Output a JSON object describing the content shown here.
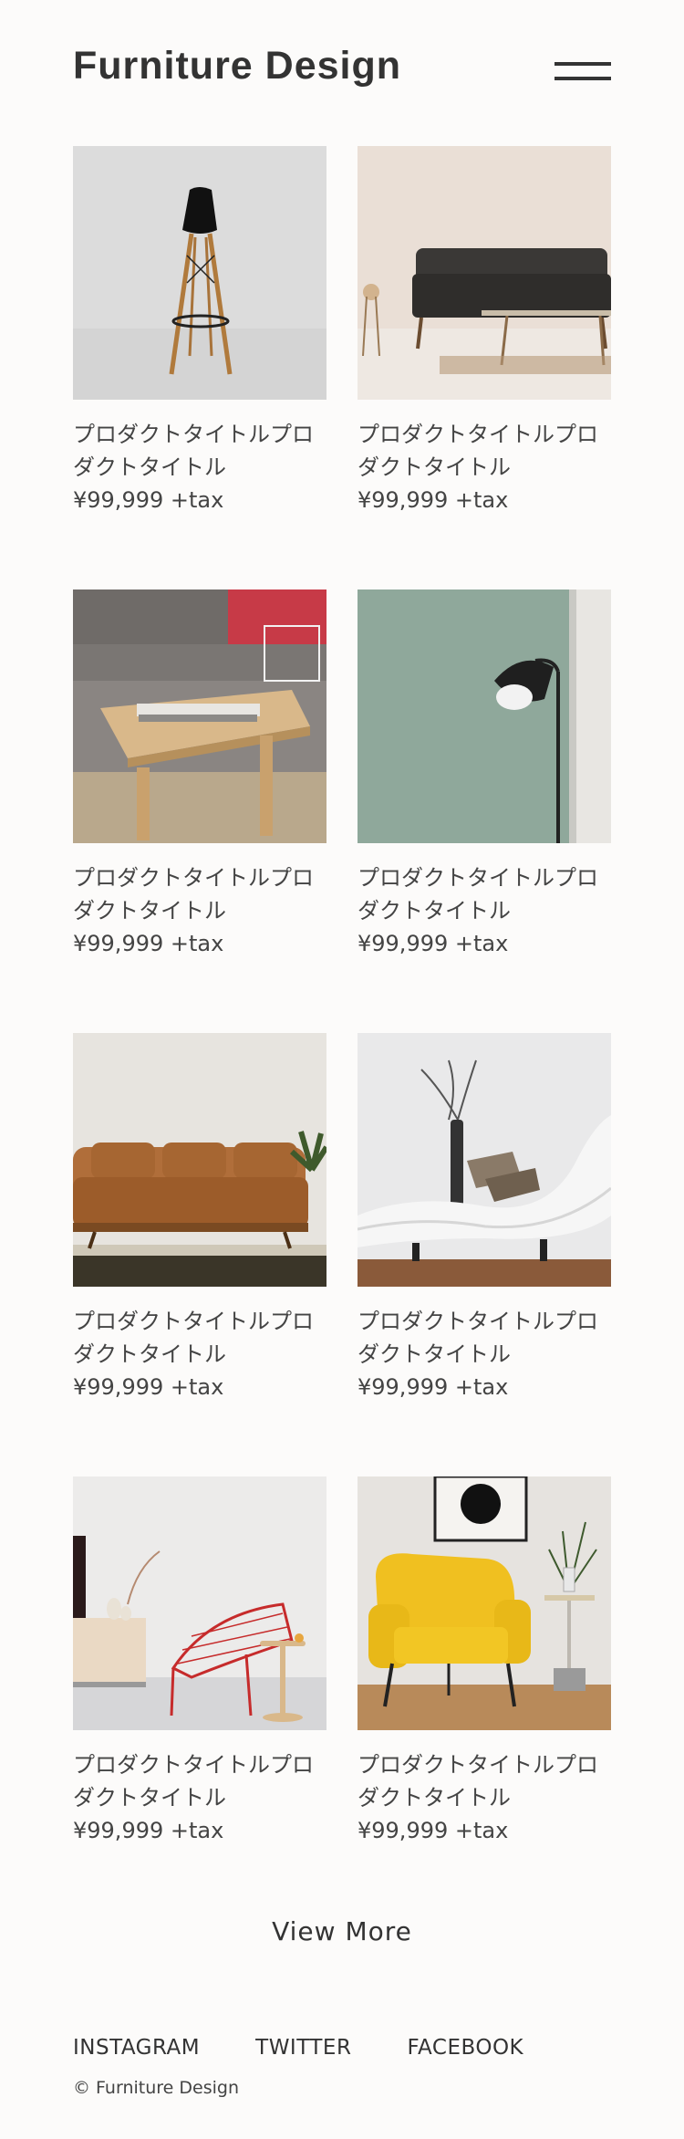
{
  "header": {
    "logo": "Furniture Design",
    "menu_icon": "hamburger-menu-icon"
  },
  "products": [
    {
      "image": "black-bar-stool",
      "title": "プロダクトタイトルプロダクトタイトル",
      "price": "¥99,999 +tax"
    },
    {
      "image": "dark-leather-sofa",
      "title": "プロダクトタイトルプロダクトタイトル",
      "price": "¥99,999 +tax"
    },
    {
      "image": "wooden-coffee-table",
      "title": "プロダクトタイトルプロダクトタイトル",
      "price": "¥99,999 +tax"
    },
    {
      "image": "black-floor-lamp",
      "title": "プロダクトタイトルプロダクトタイトル",
      "price": "¥99,999 +tax"
    },
    {
      "image": "brown-leather-sofa",
      "title": "プロダクトタイトルプロダクトタイトル",
      "price": "¥99,999 +tax"
    },
    {
      "image": "white-chaise-lounge",
      "title": "プロダクトタイトルプロダクトタイトル",
      "price": "¥99,999 +tax"
    },
    {
      "image": "red-wire-chair",
      "title": "プロダクトタイトルプロダクトタイトル",
      "price": "¥99,999 +tax"
    },
    {
      "image": "yellow-armchair",
      "title": "プロダクトタイトルプロダクトタイトル",
      "price": "¥99,999 +tax"
    }
  ],
  "view_more": "View More",
  "footer": {
    "links": [
      "INSTAGRAM",
      "TWITTER",
      "FACEBOOK"
    ],
    "copyright": "© Furniture Design"
  },
  "colors": {
    "background": "#fcfbfa",
    "text": "#333333"
  }
}
